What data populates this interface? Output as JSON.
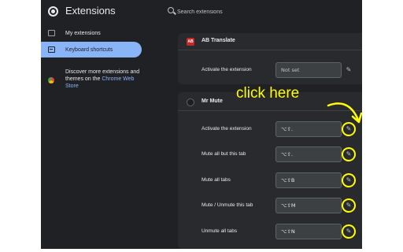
{
  "app": {
    "title": "Extensions"
  },
  "search": {
    "placeholder": "Search extensions"
  },
  "sidebar": {
    "items": [
      {
        "label": "My extensions",
        "icon": "puzzle-icon",
        "active": false
      },
      {
        "label": "Keyboard shortcuts",
        "icon": "keyboard-icon",
        "active": true
      }
    ],
    "store": {
      "text": "Discover more extensions and themes on the ",
      "link": "Chrome Web Store",
      "icon": "chrome-web-store-icon"
    }
  },
  "extensions": [
    {
      "name": "AB Translate",
      "icon_text": "AB",
      "shortcuts": [
        {
          "label": "Activate the extension",
          "value": "Not set"
        }
      ]
    },
    {
      "name": "Mr Mute",
      "icon_text": "",
      "shortcuts": [
        {
          "label": "Activate the extension",
          "value": "⌥⇧."
        },
        {
          "label": "Mute all but this tab",
          "value": "⌥⇧."
        },
        {
          "label": "Mute all tabs",
          "value": "⌥⇧B"
        },
        {
          "label": "Mute / Unmute this tab",
          "value": "⌥⇧M"
        },
        {
          "label": "Unmute all tabs",
          "value": "⌥⇧N"
        }
      ]
    }
  ],
  "annotation": {
    "text": "click here",
    "color": "#ffff00"
  },
  "colors": {
    "background": "#202124",
    "card": "#292a2d",
    "accent": "#8ab4f8",
    "highlight": "#ffff00"
  }
}
